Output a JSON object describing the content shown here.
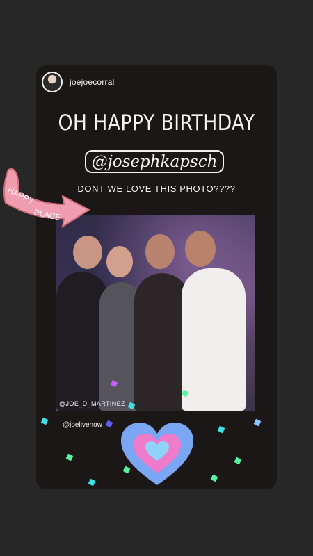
{
  "story": {
    "username": "joejoecorral",
    "headline": "OH HAPPY BIRTHDAY",
    "mention": "@josephkapsch",
    "subline": "DONT WE LOVE THIS PHOTO????",
    "photo_tag": "@JOE_D_MARTINEZ",
    "bottom_tag": "@joelivenow"
  },
  "stickers": {
    "arrow_text": "HAPPY PLACE",
    "heart_icon": "heart-icon"
  },
  "colors": {
    "background": "#272727",
    "card": "#1c1717",
    "sticker_pink": "#f19db0",
    "heart_blue": "#7aa6f3",
    "heart_pink": "#ee7ccb",
    "confetti_cyan": "#3ee0e6",
    "confetti_green": "#56f59d"
  }
}
